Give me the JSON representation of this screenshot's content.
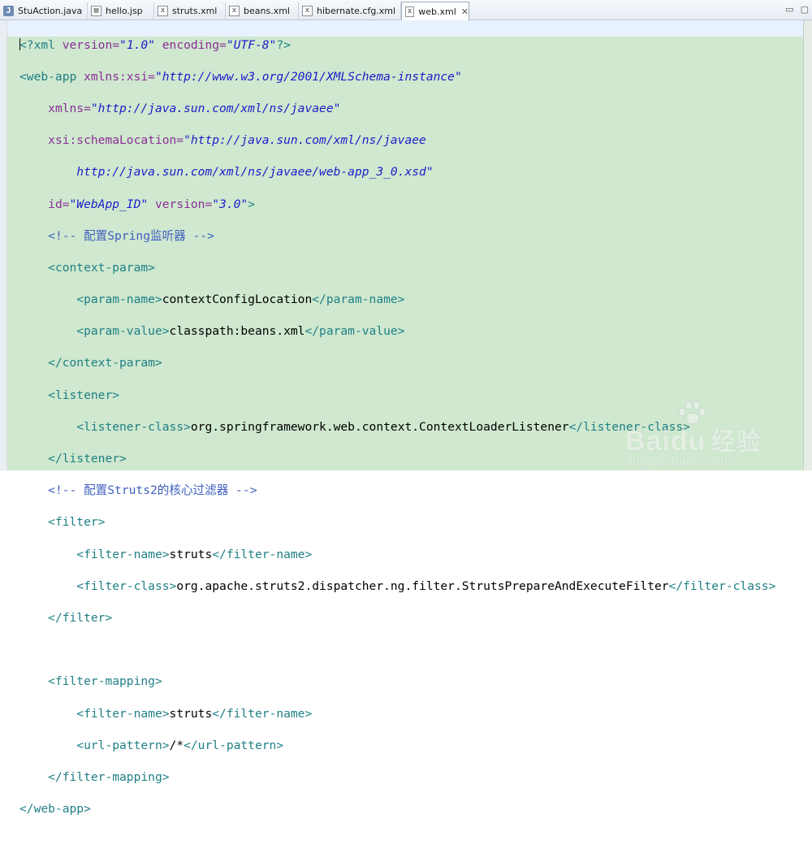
{
  "tabs": [
    {
      "label": "StuAction.java",
      "icon": "java-file-icon"
    },
    {
      "label": "hello.jsp",
      "icon": "jsp-file-icon"
    },
    {
      "label": "struts.xml",
      "icon": "xml-file-icon"
    },
    {
      "label": "beans.xml",
      "icon": "xml-file-icon"
    },
    {
      "label": "hibernate.cfg.xml",
      "icon": "xml-file-icon"
    },
    {
      "label": "web.xml",
      "icon": "xml-file-icon",
      "active": true
    }
  ],
  "window_controls": {
    "minimize": "▭",
    "maximize": "▢"
  },
  "code": {
    "l1": {
      "pi_open": "<?",
      "pi_name": "xml ",
      "a1": "version=",
      "v1": "\"1.0\"",
      "a2": " encoding=",
      "v2": "\"UTF-8\"",
      "pi_close": "?>"
    },
    "l2": {
      "tag": "<web-app ",
      "attr": "xmlns:xsi=",
      "val": "\"http://www.w3.org/2001/XMLSchema-instance\""
    },
    "l3": {
      "attr": "xmlns=",
      "val": "\"http://java.sun.com/xml/ns/javaee\""
    },
    "l4": {
      "attr": "xsi:schemaLocation=",
      "val": "\"http://java.sun.com/xml/ns/javaee"
    },
    "l5": {
      "val": "http://java.sun.com/xml/ns/javaee/web-app_3_0.xsd\""
    },
    "l6": {
      "attr": "id=",
      "val": "\"WebApp_ID\"",
      "attr2": " version=",
      "val2": "\"3.0\"",
      "close": ">"
    },
    "l7": {
      "comment": "<!-- 配置Spring监听器 -->"
    },
    "l8": {
      "tag": "<context-param>"
    },
    "l9": {
      "open": "<param-name>",
      "text": "contextConfigLocation",
      "close": "</param-name>"
    },
    "l10": {
      "open": "<param-value>",
      "text": "classpath:beans.xml",
      "close": "</param-value>"
    },
    "l11": {
      "tag": "</context-param>"
    },
    "l12": {
      "tag": "<listener>"
    },
    "l13": {
      "open": "<listener-class>",
      "text": "org.springframework.web.context.ContextLoaderListener",
      "close": "</listener-class>"
    },
    "l14": {
      "tag": "</listener>"
    },
    "l15": {
      "comment": "<!-- 配置Struts2的核心过滤器 -->"
    },
    "l16": {
      "tag": "<filter>"
    },
    "l17": {
      "open": "<filter-name>",
      "text": "struts",
      "close": "</filter-name>"
    },
    "l18": {
      "open": "<filter-class>",
      "text": "org.apache.struts2.dispatcher.ng.filter.StrutsPrepareAndExecuteFilter",
      "close": "</filter-class>"
    },
    "l19": {
      "tag": "</filter>"
    },
    "l21": {
      "tag": "<filter-mapping>"
    },
    "l22": {
      "open": "<filter-name>",
      "text": "struts",
      "close": "</filter-name>"
    },
    "l23": {
      "open": "<url-pattern>",
      "text": "/*",
      "close": "</url-pattern>"
    },
    "l24": {
      "tag": "</filter-mapping>"
    },
    "l25": {
      "tag": "</web-app>"
    }
  },
  "watermark": {
    "logo": "Bai",
    "logo2": "du",
    "cn": "经验",
    "sub": "jingyan.baidu.com"
  }
}
